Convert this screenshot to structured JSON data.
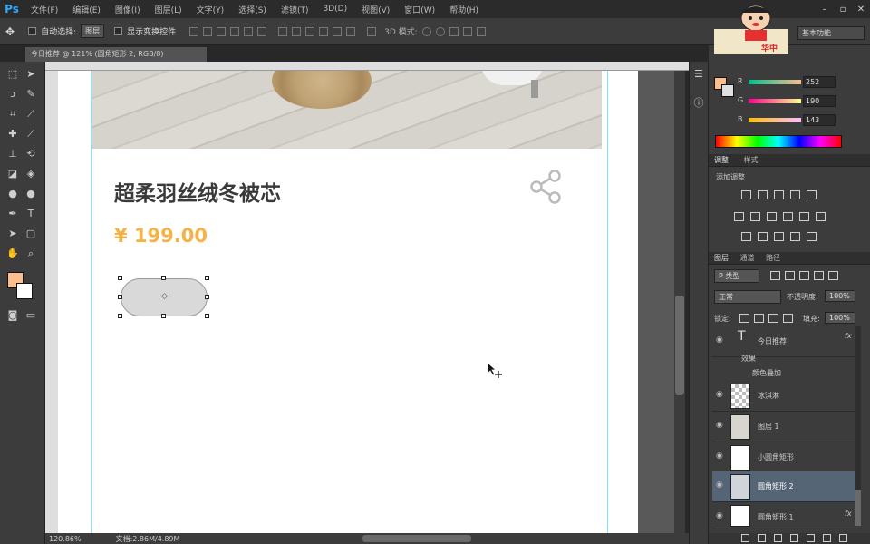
{
  "app": {
    "logo": "Ps"
  },
  "menu": [
    "文件(F)",
    "编辑(E)",
    "图像(I)",
    "图层(L)",
    "文字(Y)",
    "选择(S)",
    "滤镜(T)",
    "3D(D)",
    "视图(V)",
    "窗口(W)",
    "帮助(H)"
  ],
  "options": {
    "auto_select": "自动选择:",
    "auto_select_target": "图层",
    "show_transform": "显示变换控件",
    "mode_3d": "3D 模式:"
  },
  "workspace": "基本功能",
  "document_tab": "今日推荐 @ 121% (圆角矩形 2, RGB/8)",
  "artboard": {
    "title": "超柔羽丝绒冬被芯",
    "price": "¥  199.00"
  },
  "status": {
    "zoom": "120.86%",
    "doc": "文档:2.86M/4.89M"
  },
  "color_panel": {
    "r_label": "R",
    "r": "252",
    "g_label": "G",
    "g": "190",
    "b_label": "B",
    "b": "143",
    "fg_color": "#fcbe8f"
  },
  "adjust_panel": {
    "tabs": [
      "调整",
      "样式"
    ],
    "title": "添加调整"
  },
  "layers_panel": {
    "tabs": [
      "图层",
      "通道",
      "路径"
    ],
    "filter": "P 类型",
    "blend": "正常",
    "opacity_label": "不透明度:",
    "opacity": "100%",
    "lock_label": "锁定:",
    "fill_label": "填充:",
    "fill": "100%",
    "layers": [
      {
        "name": "今日推荐"
      },
      {
        "name": "效果"
      },
      {
        "name": "颜色叠加"
      },
      {
        "name": "冰淇淋"
      },
      {
        "name": "图层 1"
      },
      {
        "name": "小圆角矩形"
      },
      {
        "name": "圆角矩形 2"
      },
      {
        "name": "圆角矩形 1"
      }
    ]
  },
  "mascot_text": "华中"
}
